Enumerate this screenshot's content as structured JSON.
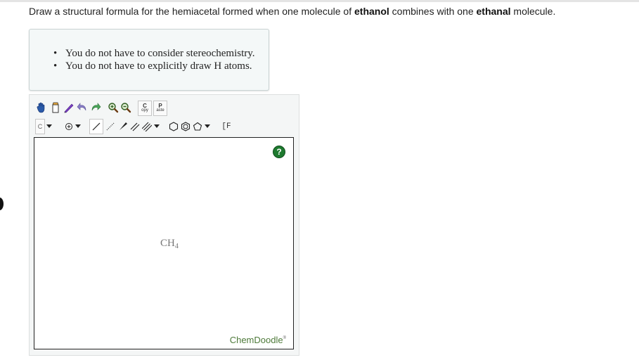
{
  "question": {
    "part1": "Draw a structural formula for the hemiacetal formed when one molecule of ",
    "bold1": "ethanol",
    "part2": " combines with one ",
    "bold2": "ethanal",
    "part3": " molecule."
  },
  "hints": [
    "You do not have to consider stereochemistry.",
    "You do not have to explicitly draw H atoms."
  ],
  "toolbar": {
    "element_label": "C",
    "copy_label_big": "C",
    "copy_label_small": "opy",
    "paste_label_big": "P",
    "paste_label_small": "aste",
    "bracket_label": "[F"
  },
  "canvas": {
    "molecule_main": "CH",
    "molecule_sub": "4",
    "help_label": "?",
    "brand": "ChemDoodle",
    "brand_mark": "®"
  },
  "colors": {
    "help_icon": "#1e7a2f",
    "brand": "#4e7a3a"
  }
}
